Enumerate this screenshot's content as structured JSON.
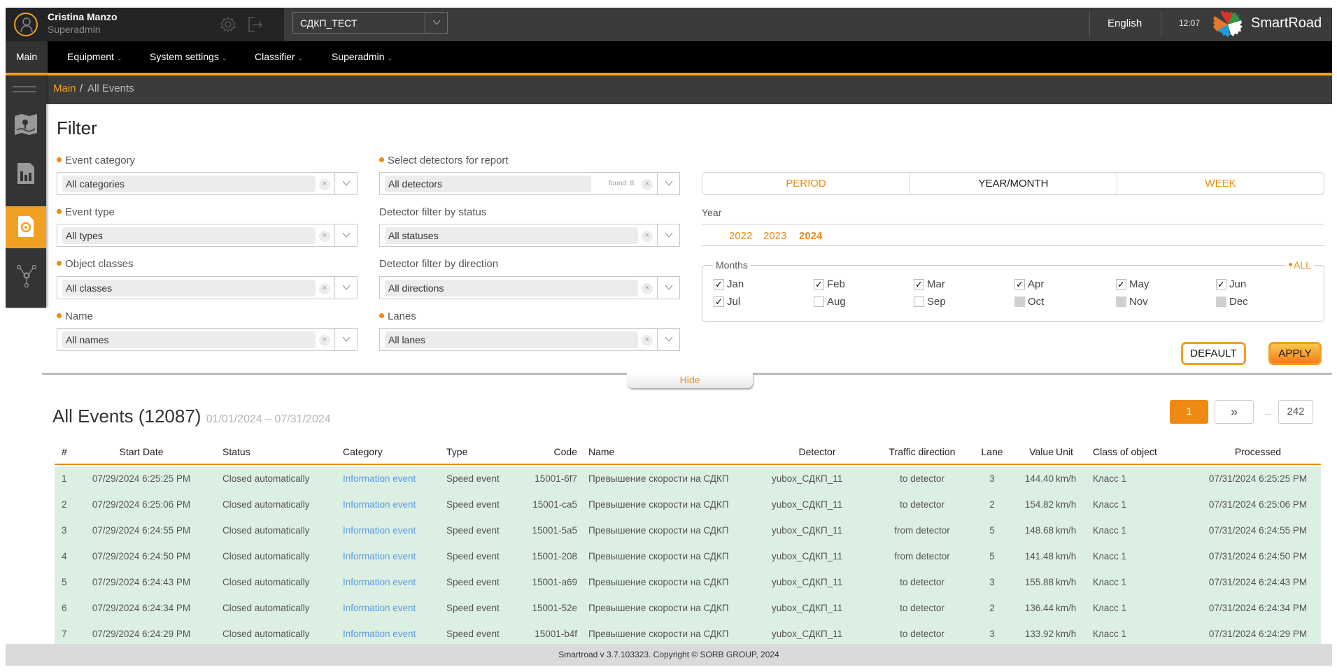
{
  "header": {
    "user_name": "Cristina Manzo",
    "user_role": "Superadmin",
    "site_selector": "СДКП_ТЕСТ",
    "language": "English",
    "time": "12:07",
    "brand": "SmartRoad"
  },
  "nav": {
    "items": [
      {
        "label": "Main",
        "active": true,
        "dropdown": false
      },
      {
        "label": "Equipment",
        "dropdown": true
      },
      {
        "label": "System settings",
        "dropdown": true
      },
      {
        "label": "Classifier",
        "dropdown": true
      },
      {
        "label": "Superadmin",
        "dropdown": true
      }
    ],
    "chevron": "⌄"
  },
  "breadcrumb": {
    "root": "Main",
    "separator": "/",
    "current": "All Events"
  },
  "sidebar": {
    "items": [
      {
        "icon": "menu-icon"
      },
      {
        "icon": "map-icon"
      },
      {
        "icon": "report-icon"
      },
      {
        "icon": "events-icon",
        "active": true
      },
      {
        "icon": "network-icon"
      }
    ]
  },
  "filter": {
    "title": "Filter",
    "fields": {
      "event_category": {
        "label": "Event category",
        "required": true,
        "value": "All categories"
      },
      "event_type": {
        "label": "Event type",
        "required": true,
        "value": "All types"
      },
      "object_classes": {
        "label": "Object classes",
        "required": true,
        "value": "All classes"
      },
      "name": {
        "label": "Name",
        "required": true,
        "value": "All names"
      },
      "detectors": {
        "label": "Select detectors for report",
        "required": true,
        "value": "All detectors",
        "found": "found: 8"
      },
      "detector_status": {
        "label": "Detector filter by status",
        "required": false,
        "value": "All statuses"
      },
      "detector_direction": {
        "label": "Detector filter by direction",
        "required": false,
        "value": "All directions"
      },
      "lanes": {
        "label": "Lanes",
        "required": true,
        "value": "All lanes"
      }
    },
    "clear_glyph": "×",
    "period_tabs": [
      {
        "label": "PERIOD"
      },
      {
        "label": "YEAR/MONTH",
        "active": true
      },
      {
        "label": "WEEK"
      }
    ],
    "year_label": "Year",
    "years": [
      {
        "label": "2022"
      },
      {
        "label": "2023"
      },
      {
        "label": "2024",
        "active": true
      }
    ],
    "months_label": "Months",
    "months_all": "ALL",
    "months": [
      {
        "label": "Jan",
        "state": "checked"
      },
      {
        "label": "Feb",
        "state": "checked"
      },
      {
        "label": "Mar",
        "state": "checked"
      },
      {
        "label": "Apr",
        "state": "checked"
      },
      {
        "label": "May",
        "state": "checked"
      },
      {
        "label": "Jun",
        "state": "checked"
      },
      {
        "label": "Jul",
        "state": "checked"
      },
      {
        "label": "Aug",
        "state": "unchecked"
      },
      {
        "label": "Sep",
        "state": "unchecked"
      },
      {
        "label": "Oct",
        "state": "disabled"
      },
      {
        "label": "Nov",
        "state": "disabled"
      },
      {
        "label": "Dec",
        "state": "disabled"
      }
    ],
    "default_label": "DEFAULT",
    "apply_label": "APPLY",
    "hide_label": "Hide"
  },
  "events": {
    "title": "All Events (12087)",
    "range": "01/01/2024 – 07/31/2024",
    "pagination": {
      "current": "1",
      "next": "»",
      "ellipsis": "...",
      "last": "242"
    },
    "columns": [
      "#",
      "Start Date",
      "Status",
      "Category",
      "Type",
      "Code",
      "Name",
      "Detector",
      "Traffic direction",
      "Lane",
      "Value",
      "Unit",
      "Class of object",
      "Processed"
    ],
    "rows": [
      [
        "1",
        "07/29/2024 6:25:25 PM",
        "Closed automatically",
        "Information event",
        "Speed event",
        "15001-6f7",
        "Превышение скорости на СДКП",
        "yubox_СДКП_11",
        "to detector",
        "3",
        "144.40",
        "km/h",
        "Класс 1",
        "07/31/2024 6:25:25 PM"
      ],
      [
        "2",
        "07/29/2024 6:25:06 PM",
        "Closed automatically",
        "Information event",
        "Speed event",
        "15001-ca5",
        "Превышение скорости на СДКП",
        "yubox_СДКП_11",
        "to detector",
        "2",
        "154.82",
        "km/h",
        "Класс 1",
        "07/31/2024 6:25:06 PM"
      ],
      [
        "3",
        "07/29/2024 6:24:55 PM",
        "Closed automatically",
        "Information event",
        "Speed event",
        "15001-5a5",
        "Превышение скорости на СДКП",
        "yubox_СДКП_11",
        "from detector",
        "5",
        "148.68",
        "km/h",
        "Класс 1",
        "07/31/2024 6:24:55 PM"
      ],
      [
        "4",
        "07/29/2024 6:24:50 PM",
        "Closed automatically",
        "Information event",
        "Speed event",
        "15001-208",
        "Превышение скорости на СДКП",
        "yubox_СДКП_11",
        "from detector",
        "5",
        "141.48",
        "km/h",
        "Класс 1",
        "07/31/2024 6:24:50 PM"
      ],
      [
        "5",
        "07/29/2024 6:24:43 PM",
        "Closed automatically",
        "Information event",
        "Speed event",
        "15001-a69",
        "Превышение скорости на СДКП",
        "yubox_СДКП_11",
        "to detector",
        "3",
        "155.88",
        "km/h",
        "Класс 1",
        "07/31/2024 6:24:43 PM"
      ],
      [
        "6",
        "07/29/2024 6:24:34 PM",
        "Closed automatically",
        "Information event",
        "Speed event",
        "15001-52e",
        "Превышение скорости на СДКП",
        "yubox_СДКП_11",
        "to detector",
        "2",
        "136.44",
        "km/h",
        "Класс 1",
        "07/31/2024 6:24:34 PM"
      ],
      [
        "7",
        "07/29/2024 6:24:29 PM",
        "Closed automatically",
        "Information event",
        "Speed event",
        "15001-b4f",
        "Превышение скорости на СДКП",
        "yubox_СДКП_11",
        "to detector",
        "3",
        "133.92",
        "km/h",
        "Класс 1",
        "07/31/2024 6:24:29 PM"
      ]
    ]
  },
  "footer": {
    "text": "Smartroad v 3.7.103323. Copyright © SORB GROUP, 2024"
  },
  "colors": {
    "accent": "#f2a023",
    "accent_text": "#ee8a12",
    "header_bg": "#3a3b3b",
    "nav_bg": "#000000",
    "row_bg": "#dcefe3",
    "link": "#5a9be0"
  }
}
